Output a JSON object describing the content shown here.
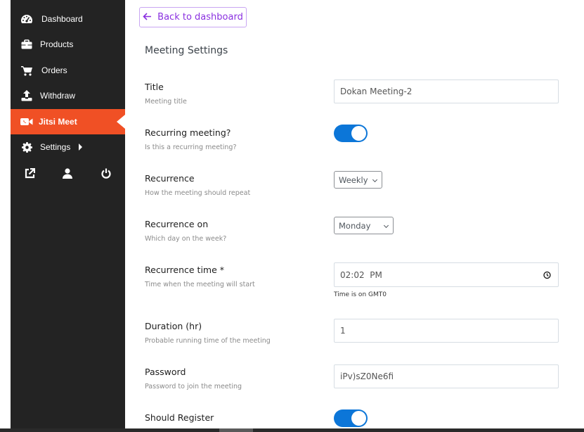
{
  "sidebar": {
    "items": [
      {
        "label": "Dashboard",
        "icon": "dashboard-gauge-icon",
        "active": false
      },
      {
        "label": "Products",
        "icon": "briefcase-icon",
        "active": false
      },
      {
        "label": "Orders",
        "icon": "shopping-cart-icon",
        "active": false
      },
      {
        "label": "Withdraw",
        "icon": "upload-icon",
        "active": false
      },
      {
        "label": "Jitsi Meet",
        "icon": "video-camera-icon",
        "active": true
      },
      {
        "label": "Settings",
        "icon": "gear-icon",
        "active": false,
        "has_submenu": true
      }
    ],
    "bottom_icons": [
      "external-link-icon",
      "user-icon",
      "power-icon"
    ],
    "colors": {
      "background": "#232323",
      "active": "#f05025"
    }
  },
  "header": {
    "back_button_label": "Back to dashboard",
    "back_icon": "arrow-left-icon",
    "page_title": "Meeting Settings"
  },
  "form": {
    "title": {
      "label": "Title",
      "description": "Meeting title",
      "value": "Dokan Meeting-2"
    },
    "recurring": {
      "label": "Recurring meeting?",
      "description": "Is this a recurring meeting?",
      "checked": true
    },
    "recurrence": {
      "label": "Recurrence",
      "description": "How the meeting should repeat",
      "selected": "Weekly"
    },
    "recurrence_on": {
      "label": "Recurrence on",
      "description": "Which day on the week?",
      "selected": "Monday"
    },
    "recurrence_time": {
      "label": "Recurrence time *",
      "description": "Time when the meeting will start",
      "value": "02:02  PM",
      "hint": "Time is on GMT0"
    },
    "duration": {
      "label": "Duration (hr)",
      "description": "Probable running time of the meeting",
      "value": "1"
    },
    "password": {
      "label": "Password",
      "description": "Password to join the meeting",
      "value": "iPv)sZ0Ne6fi"
    },
    "should_register": {
      "label": "Should Register",
      "checked": true
    }
  },
  "colors": {
    "accent_purple": "#8a30e0",
    "toggle_blue": "#0c76d8"
  }
}
